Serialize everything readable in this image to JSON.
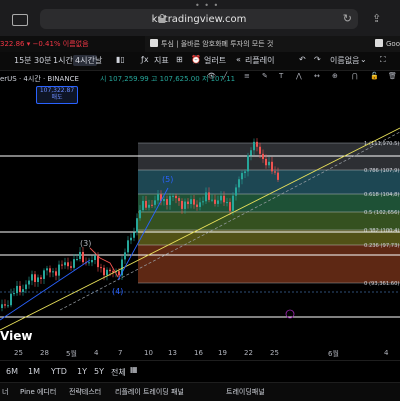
{
  "browser": {
    "url": "kr.tradingview.com",
    "tabs": [
      {
        "label": "322.86 ▾ −0.41% 이름없음"
      },
      {
        "label": "투심 | 올바른 암호화폐 투자의 모든 것"
      },
      {
        "label": "Goog"
      }
    ]
  },
  "toolbar": {
    "tf_15m": "15분",
    "tf_30m": "30분",
    "tf_1h": "1시간",
    "tf_4h": "4시간",
    "tf_day": "날",
    "indicators": "지표",
    "alert": "얼러트",
    "replay": "리플레이",
    "layout_name": "이름없음"
  },
  "symbol": {
    "name": "erUS · 4시간 · BINANCE",
    "ohlc": "시 107,259.99  고 107,625.00  저 107,11",
    "badge_price": "107,322.87",
    "badge_sub": "매도"
  },
  "chart_data": {
    "type": "candlestick",
    "fib_levels": [
      {
        "ratio": "1",
        "price": "111,970.5"
      },
      {
        "ratio": "0.786",
        "price": "107,9"
      },
      {
        "ratio": "0.618",
        "price": "104,8"
      },
      {
        "ratio": "0.5",
        "price": "102,656"
      },
      {
        "ratio": "0.382",
        "price": "100,4"
      },
      {
        "ratio": "0.236",
        "price": "97,73"
      },
      {
        "ratio": "0",
        "price": "93,361.60"
      }
    ],
    "wave_labels": [
      "(3)",
      "(4)",
      "(5)"
    ],
    "x_ticks": [
      "25",
      "28",
      "5월",
      "4",
      "7",
      "10",
      "13",
      "16",
      "19",
      "22",
      "25",
      "6월",
      "4"
    ],
    "colors": {
      "up": "#26a69a",
      "down": "#ef5350",
      "trend": "#e8e05a",
      "elliott": "#2962ff"
    }
  },
  "range": {
    "r6m": "6M",
    "r1m": "1M",
    "ytd": "YTD",
    "r1y": "1Y",
    "r5y": "5Y",
    "all": "전체"
  },
  "bottom": {
    "b1": "너",
    "b2": "Pine 에디터",
    "b3": "전략테스터",
    "b4": "리플레이 트레이딩 패널",
    "b5": "트레이딩패널"
  },
  "watermark": "View"
}
